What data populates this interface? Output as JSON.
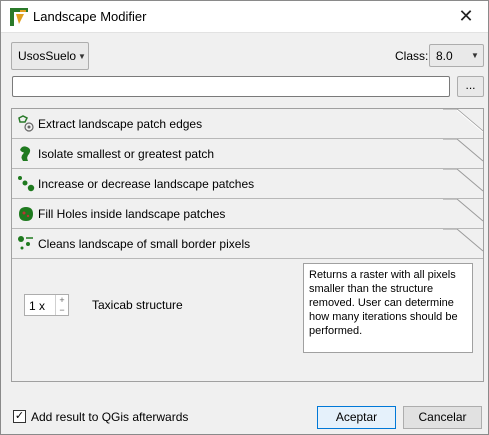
{
  "window": {
    "title": "Landscape Modifier"
  },
  "top": {
    "layer_combo": "UsosSuelo",
    "class_label": "Class:",
    "class_combo": "8.0",
    "path_value": "",
    "browse_label": "..."
  },
  "toolbox": {
    "items": [
      {
        "label": "Extract landscape patch edges",
        "icon": "edges-icon"
      },
      {
        "label": "Isolate smallest or greatest patch",
        "icon": "patch-icon"
      },
      {
        "label": "Increase or decrease landscape patches",
        "icon": "resize-patch-icon"
      },
      {
        "label": "Fill Holes inside landscape patches",
        "icon": "fill-holes-icon"
      },
      {
        "label": "Cleans landscape of small border pixels",
        "icon": "clean-pixels-icon"
      }
    ],
    "active_page": {
      "spin_value": "1 x",
      "structure_label": "Taxicab structure",
      "description": "Returns a raster with all pixels smaller than the structure removed. User can determine how many iterations should be performed."
    }
  },
  "footer": {
    "checkbox_label": "Add result to QGis afterwards",
    "checkbox_checked": true,
    "accept_label": "Aceptar",
    "cancel_label": "Cancelar"
  }
}
